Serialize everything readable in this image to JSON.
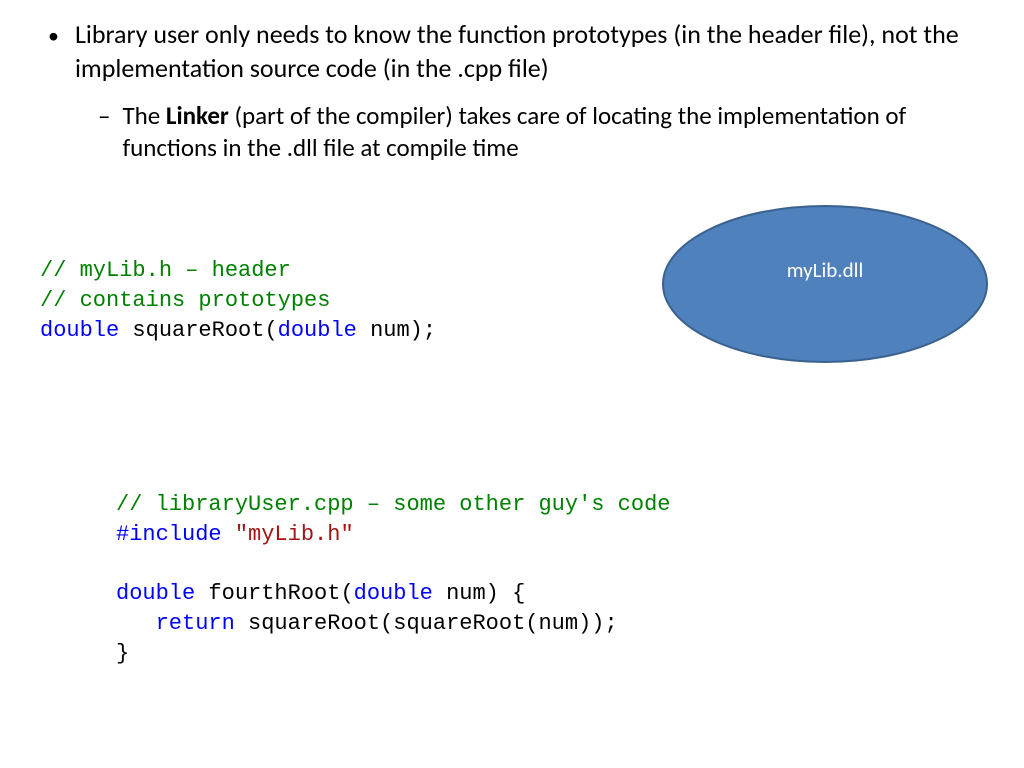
{
  "bullet_text_1": "Library user only needs to know the function prototypes (in the header file), not the implementation source code (in the .cpp file)",
  "sub_bullet_pre": "The ",
  "sub_bullet_bold": "Linker",
  "sub_bullet_post": " (part of the compiler) takes care of locating the implementation of functions in the .dll file at compile time",
  "ellipse_label": "myLib.dll",
  "code1": {
    "l1": "// myLib.h – header",
    "l2": "// contains prototypes",
    "l3a": "double",
    "l3b": " squareRoot(",
    "l3c": "double",
    "l3d": " num);"
  },
  "code2": {
    "l1": "// libraryUser.cpp – some other guy's code",
    "l2a": "#include",
    "l2b": " ",
    "l2c": "\"myLib.h\"",
    "l4a": "double",
    "l4b": " fourthRoot(",
    "l4c": "double",
    "l4d": " num) {",
    "l5a": "   ",
    "l5b": "return",
    "l5c": " squareRoot(squareRoot(num));",
    "l6": "}"
  }
}
